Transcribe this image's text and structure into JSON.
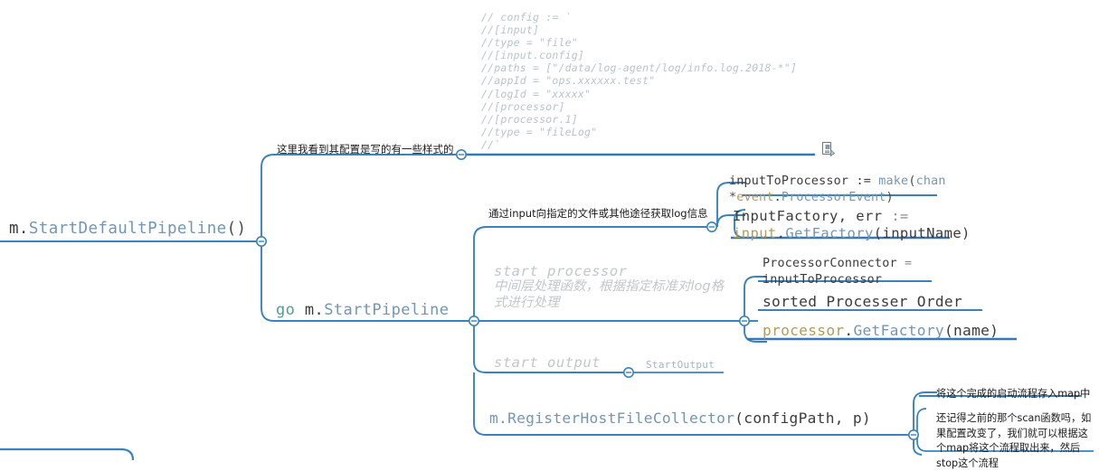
{
  "document": {
    "type": "mindmap",
    "background": "#ffffff",
    "accent_color": "#2f7cc0",
    "line_color": "#3a82bd"
  },
  "nodes": {
    "root": {
      "name": "m.StartDefaultPipeline()",
      "tokens": [
        {
          "t": "m.",
          "c": "plain"
        },
        {
          "t": "StartDefaultPipeline",
          "c": "blue"
        },
        {
          "t": "()",
          "c": "paren"
        }
      ]
    },
    "config_comment": {
      "label": "这里我看到其配置是写的有一些样式的",
      "code": [
        "// config := `",
        "//[input]",
        "//type = \"file\"",
        "//[input.config]",
        "//paths = [\"/data/log-agent/log/info.log.2018-*\"]",
        "//appId = \"ops.xxxxxx.test\"",
        "//logId = \"xxxxx\"",
        "//[processor]",
        "//[processor.1]",
        "//type = \"fileLog\"",
        "//`"
      ],
      "icon": "note-icon"
    },
    "start_pipeline": {
      "name": "go m.StartPipeline",
      "tokens": [
        {
          "t": "go ",
          "c": "teal"
        },
        {
          "t": "m.",
          "c": "plain"
        },
        {
          "t": "StartPipeline",
          "c": "blue"
        }
      ]
    },
    "input_branch": {
      "label": "通过input向指定的文件或其他途径获取log信息",
      "children": [
        {
          "name": "inputToProcessor := make(chan *event.ProcessorEvent)",
          "lines": [
            [
              {
                "t": "inputToProcessor ",
                "c": "plain"
              },
              {
                "t": ":= ",
                "c": "plain"
              },
              {
                "t": "make",
                "c": "blue"
              },
              {
                "t": "(",
                "c": "paren"
              },
              {
                "t": "chan",
                "c": "blue"
              }
            ],
            [
              {
                "t": "*",
                "c": "paren"
              },
              {
                "t": "event",
                "c": "olive"
              },
              {
                "t": ".",
                "c": "plain"
              },
              {
                "t": "ProcessorEvent",
                "c": "blue"
              },
              {
                "t": ")",
                "c": "paren"
              }
            ]
          ]
        },
        {
          "name": "InputFactory, err := input.GetFactory(inputName)",
          "lines": [
            [
              {
                "t": "InputFactory, err ",
                "c": "plain"
              },
              {
                "t": ":=",
                "c": "gray"
              }
            ],
            [
              {
                "t": "input",
                "c": "olive"
              },
              {
                "t": ".",
                "c": "plain"
              },
              {
                "t": "GetFactory",
                "c": "blue"
              },
              {
                "t": "(inputName)",
                "c": "plain"
              }
            ]
          ]
        }
      ]
    },
    "processor_branch": {
      "title_en": "start processor",
      "title_cjk": "中间层处理函数，根据指定标准对log格式进行处理",
      "children": [
        {
          "name": "ProcessorConnector = inputToProcessor",
          "lines": [
            [
              {
                "t": "ProcessorConnector ",
                "c": "plain"
              },
              {
                "t": "=",
                "c": "gray"
              }
            ],
            [
              {
                "t": "inputToProcessor",
                "c": "plain"
              }
            ]
          ]
        },
        {
          "name": "sorted Processer Order",
          "lines": [
            [
              {
                "t": "sorted Processer Order",
                "c": "plain"
              }
            ]
          ]
        },
        {
          "name": "processor.GetFactory(name)",
          "lines": [
            [
              {
                "t": "processor",
                "c": "olive"
              },
              {
                "t": ".",
                "c": "plain"
              },
              {
                "t": "GetFactory",
                "c": "blue"
              },
              {
                "t": "(name)",
                "c": "plain"
              }
            ]
          ]
        }
      ]
    },
    "output_branch": {
      "title_en": "start output",
      "child": "StartOutput"
    },
    "register_collector": {
      "name": "m.RegisterHostFileCollector(configPath, p)",
      "tokens": [
        {
          "t": "m.",
          "c": "blue"
        },
        {
          "t": "RegisterHostFileCollector",
          "c": "blue"
        },
        {
          "t": "(configPath, p)",
          "c": "plain"
        }
      ],
      "annotations": {
        "label": "将这个完成的启动流程存入map中",
        "body": "还记得之前的那个scan函数吗，如果配置改变了，我们就可以根据这个map将这个流程取出来，然后stop这个流程"
      }
    }
  }
}
